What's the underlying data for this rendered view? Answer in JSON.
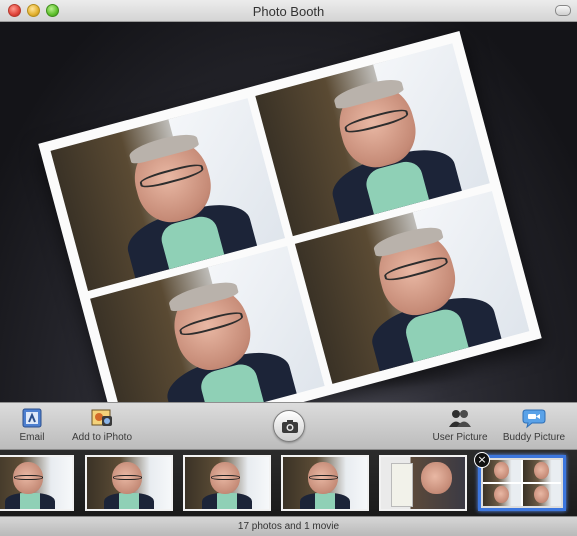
{
  "window": {
    "title": "Photo Booth"
  },
  "toolbar": {
    "email_label": "Email",
    "iphoto_label": "Add to iPhoto",
    "user_picture_label": "User Picture",
    "buddy_picture_label": "Buddy Picture"
  },
  "icons": {
    "email": "email-icon",
    "iphoto": "iphoto-icon",
    "shutter": "camera-icon",
    "user_picture": "user-picture-icon",
    "buddy_picture": "buddy-picture-icon",
    "delete": "delete-icon"
  },
  "colors": {
    "selection": "#3c76de",
    "shirt": "#8fd0b6"
  },
  "filmstrip": {
    "thumbnails": [
      {
        "type": "photo"
      },
      {
        "type": "photo"
      },
      {
        "type": "photo"
      },
      {
        "type": "photo"
      },
      {
        "type": "movie"
      },
      {
        "type": "four-up",
        "selected": true
      }
    ],
    "delete_glyph": "×"
  },
  "status": {
    "text": "17 photos and 1 movie"
  }
}
